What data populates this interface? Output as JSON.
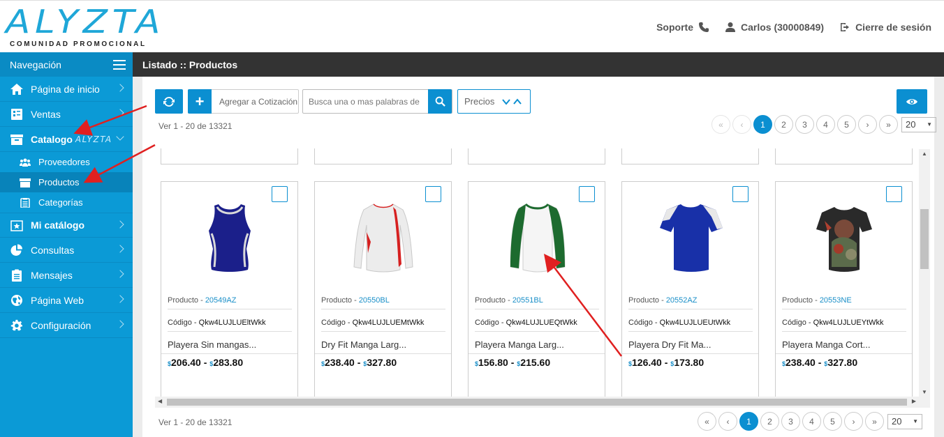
{
  "brand": {
    "logo": "ALYZTA",
    "tagline": "COMUNIDAD PROMOCIONAL"
  },
  "topnav": {
    "support": "Soporte",
    "user": "Carlos (30000849)",
    "logout": "Cierre de sesión"
  },
  "sidebar": {
    "header": "Navegación",
    "items": [
      {
        "label": "Página de inicio",
        "icon": "home-icon"
      },
      {
        "label": "Ventas",
        "icon": "ledger-icon"
      },
      {
        "label": "Catalogo",
        "icon": "box-icon",
        "brand": "ALYZTA"
      },
      {
        "label": "Mi catálogo",
        "icon": "star-box-icon"
      },
      {
        "label": "Consultas",
        "icon": "pie-chart-icon"
      },
      {
        "label": "Mensajes",
        "icon": "clipboard-icon"
      },
      {
        "label": "Página Web",
        "icon": "globe-icon"
      },
      {
        "label": "Configuración",
        "icon": "gear-icon"
      }
    ],
    "subitems": [
      {
        "label": "Proveedores",
        "icon": "users-icon"
      },
      {
        "label": "Productos",
        "icon": "archive-icon"
      },
      {
        "label": "Categorías",
        "icon": "list-icon"
      }
    ]
  },
  "page": {
    "title": "Listado :: Productos"
  },
  "toolbar": {
    "add_quote": "Agregar a Cotización",
    "search_placeholder": "Busca una o mas palabras de",
    "prices_label": "Precios"
  },
  "pagination": {
    "range_text": "Ver 1 - 20 de 13321",
    "pages": [
      "1",
      "2",
      "3",
      "4",
      "5"
    ],
    "per_page": "20",
    "first": "«",
    "prev": "‹",
    "next": "›",
    "last": "»"
  },
  "products": [
    {
      "prefix": "Producto - ",
      "id": "20549AZ",
      "code_label": "Código - ",
      "code": "Qkw4LUJLUEltWkk",
      "name": "Playera Sin mangas...",
      "price_low": "206.40",
      "price_high": "283.80",
      "currency": "$"
    },
    {
      "prefix": "Producto - ",
      "id": "20550BL",
      "code_label": "Código - ",
      "code": "Qkw4LUJLUEMtWkk",
      "name": "Dry Fit Manga Larg...",
      "price_low": "238.40",
      "price_high": "327.80",
      "currency": "$"
    },
    {
      "prefix": "Producto - ",
      "id": "20551BL",
      "code_label": "Código - ",
      "code": "Qkw4LUJLUEQtWkk",
      "name": "Playera Manga Larg...",
      "price_low": "156.80",
      "price_high": "215.60",
      "currency": "$"
    },
    {
      "prefix": "Producto - ",
      "id": "20552AZ",
      "code_label": "Código - ",
      "code": "Qkw4LUJLUEUtWkk",
      "name": "Playera Dry Fit Ma...",
      "price_low": "126.40",
      "price_high": "173.80",
      "currency": "$"
    },
    {
      "prefix": "Producto - ",
      "id": "20553NE",
      "code_label": "Código - ",
      "code": "Qkw4LUJLUEYtWkk",
      "name": "Playera Manga Cort...",
      "price_low": "238.40",
      "price_high": "327.80",
      "currency": "$"
    }
  ],
  "colors": {
    "accent": "#0b8fd1",
    "sidebar": "#0b9ad6",
    "titlebar": "#333333",
    "annotation": "#e02020"
  }
}
